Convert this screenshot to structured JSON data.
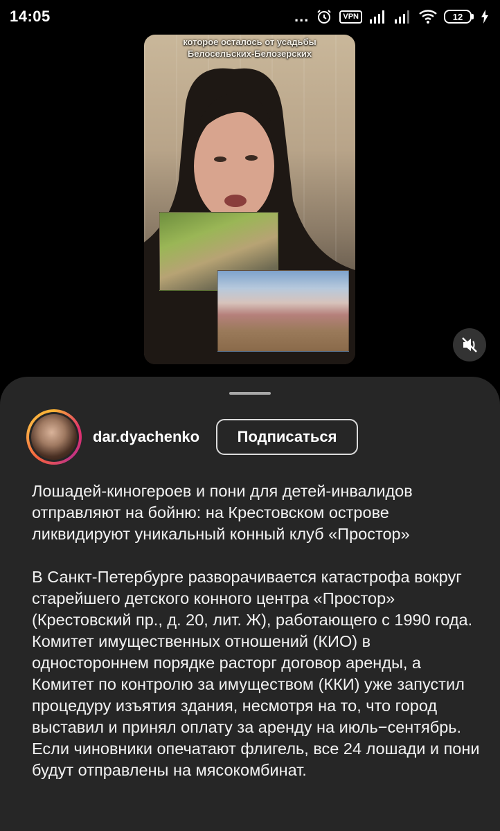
{
  "status_bar": {
    "time": "14:05",
    "dots": "...",
    "vpn": "VPN",
    "battery": "12",
    "icons": [
      "alarm-icon",
      "vpn-icon",
      "signal-icon",
      "signal-icon",
      "wifi-icon",
      "battery-icon",
      "charging-icon"
    ]
  },
  "video": {
    "caption": "которое осталось от усадьбы\nБелосельских-Белозерских",
    "mute_icon": "speaker-muted-icon"
  },
  "post": {
    "username": "dar.dyachenko",
    "follow_label": "Подписаться",
    "paragraphs": [
      "Лошадей-киногероев и пони для детей-инвалидов отправляют на бойню: на Крестовском острове ликвидируют уникальный конный клуб «Простор»",
      "В Санкт-Петербурге разворачивается катастрофа вокруг старейшего детского конного центра «Простор» (Крестовский пр., д. 20, лит. Ж), работающего с 1990 года. Комитет имущественных отношений (КИО) в одностороннем порядке расторг договор аренды, а Комитет по контролю за имуществом (ККИ) уже запустил процедуру изъятия здания, несмотря на то, что город выставил и принял оплату за аренду на июль−сентябрь. Если чиновники опечатают флигель, все 24 лошади и пони будут отправлены на мясокомбинат."
    ]
  },
  "colors": {
    "background": "#000000",
    "sheet": "#262626",
    "text": "#f2f2f2"
  }
}
